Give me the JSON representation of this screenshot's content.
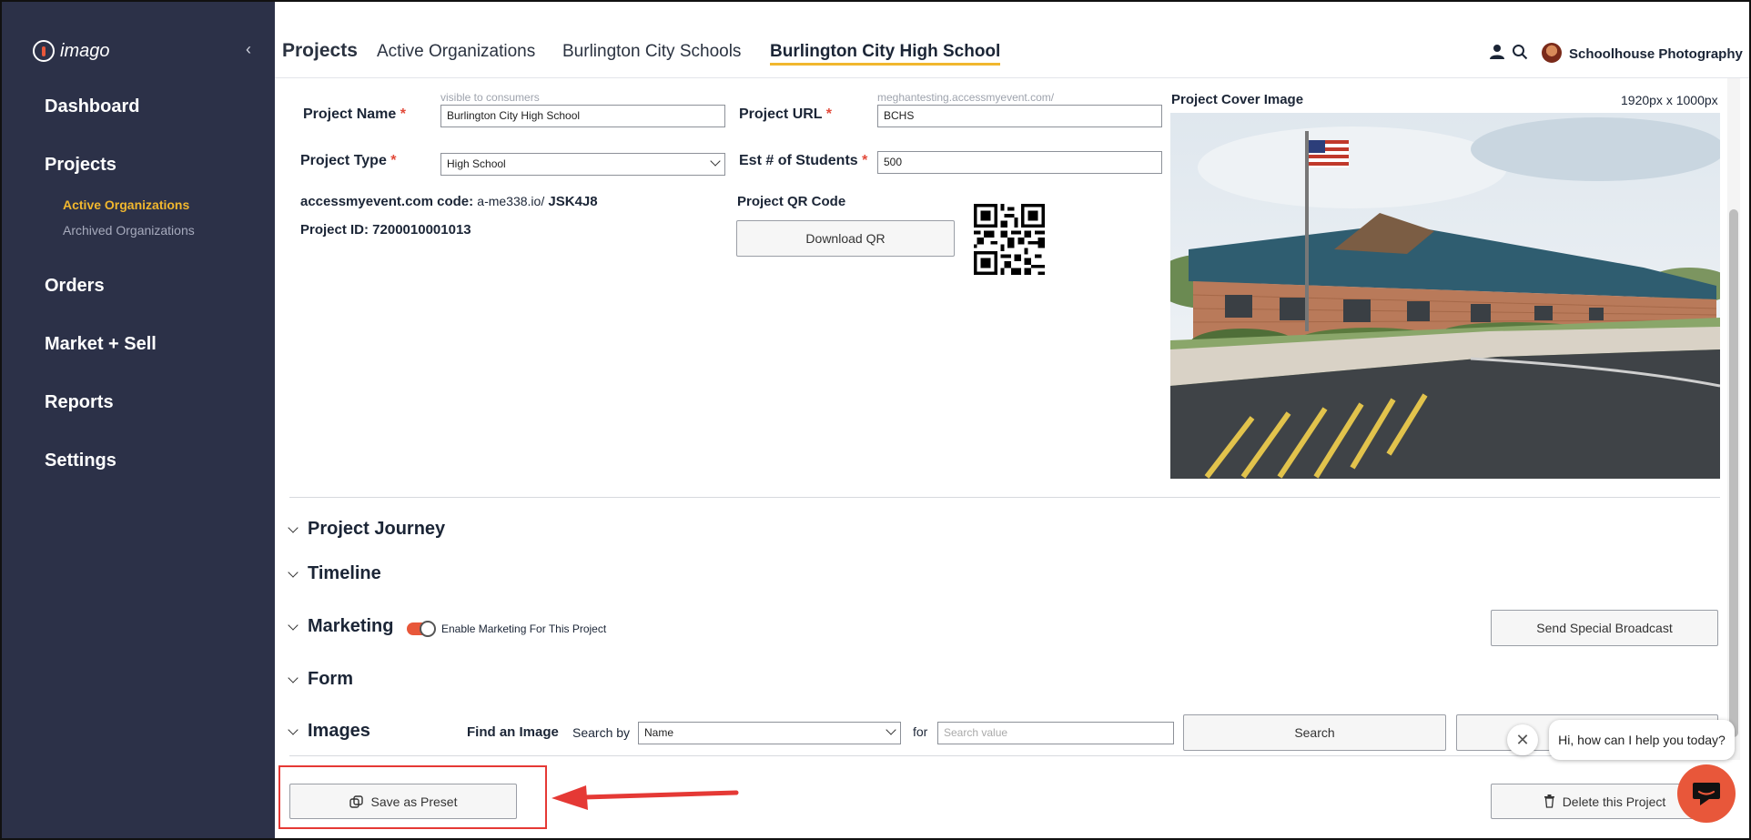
{
  "sidebar": {
    "logo_text": "imago",
    "nav": [
      {
        "label": "Dashboard"
      },
      {
        "label": "Projects"
      },
      {
        "label": "Orders"
      },
      {
        "label": "Market + Sell"
      },
      {
        "label": "Reports"
      },
      {
        "label": "Settings"
      }
    ],
    "projects_sub": [
      {
        "label": "Active Organizations",
        "active": true
      },
      {
        "label": "Archived Organizations",
        "active": false
      }
    ]
  },
  "header": {
    "breadcrumb": [
      "Projects",
      "Active Organizations",
      "Burlington City Schools",
      "Burlington City High School"
    ],
    "company": "Schoolhouse Photography"
  },
  "form": {
    "project_name": {
      "label": "Project Name",
      "hint": "visible to consumers",
      "value": "Burlington City High School"
    },
    "project_url": {
      "label": "Project URL",
      "hint": "meghantesting.accessmyevent.com/",
      "value": "BCHS"
    },
    "project_type": {
      "label": "Project Type",
      "value": "High School"
    },
    "est_students": {
      "label": "Est # of Students",
      "value": "500"
    },
    "access_code_label": "accessmyevent.com code:",
    "access_code_prefix": "a-me338.io/",
    "access_code": "JSK4J8",
    "project_id": "Project ID: 7200010001013",
    "qr_label": "Project QR Code",
    "download_qr": "Download QR",
    "cover_label": "Project Cover Image",
    "cover_size": "1920px x 1000px"
  },
  "sections": {
    "journey": "Project Journey",
    "timeline": "Timeline",
    "marketing": "Marketing",
    "marketing_toggle_label": "Enable Marketing For This Project",
    "marketing_enabled": true,
    "broadcast_button": "Send Special Broadcast",
    "form": "Form",
    "images": "Images",
    "find_image": "Find an Image",
    "search_by": "Search by",
    "search_by_value": "Name",
    "for_label": "for",
    "search_placeholder": "Search value",
    "search_button": "Search"
  },
  "footer": {
    "save_preset": "Save as Preset",
    "delete_project": "Delete this Project"
  },
  "chat": {
    "prompt": "Hi, how can I help you today?"
  },
  "colors": {
    "sidebar_bg": "#2c3148",
    "accent": "#f1b72e",
    "brand_orange": "#e8573a",
    "annotation_red": "#e53935"
  }
}
